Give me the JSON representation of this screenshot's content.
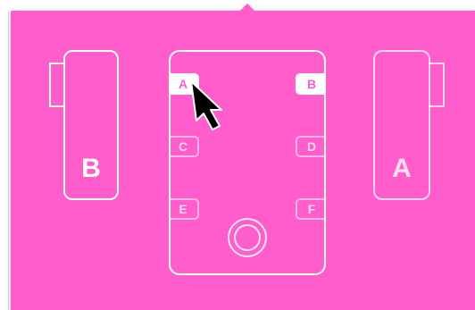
{
  "devices": {
    "left": {
      "label": "B"
    },
    "right": {
      "label": "A"
    }
  },
  "controller": {
    "slots": {
      "a": "A",
      "b": "B",
      "c": "C",
      "d": "D",
      "e": "E",
      "f": "F"
    },
    "active_slots": [
      "A",
      "B"
    ]
  },
  "colors": {
    "panel": "#ff5ccc",
    "outline": "#ffffff"
  }
}
